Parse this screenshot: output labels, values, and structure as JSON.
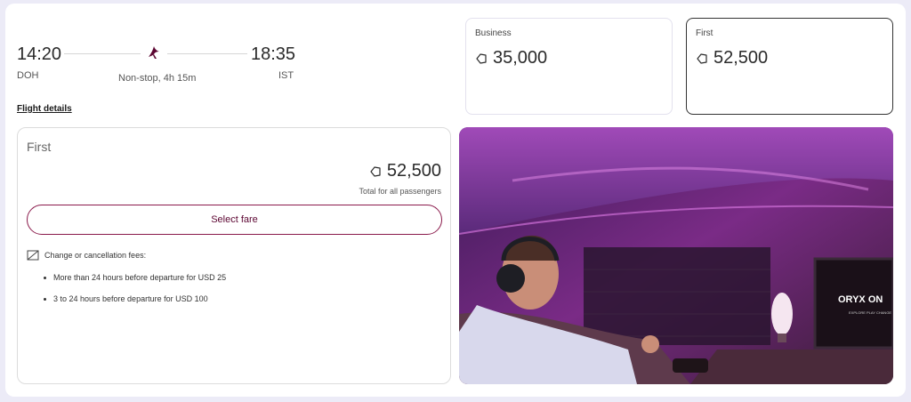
{
  "flight": {
    "depart_time": "14:20",
    "depart_code": "DOH",
    "arrive_time": "18:35",
    "arrive_code": "IST",
    "duration": "Non-stop, 4h 15m",
    "details_link": "Flight details"
  },
  "fare_tabs": [
    {
      "class": "Business",
      "points": "35,000",
      "selected": false
    },
    {
      "class": "First",
      "points": "52,500",
      "selected": true
    }
  ],
  "selected_fare": {
    "class": "First",
    "points": "52,500",
    "subtitle": "Total for all passengers",
    "select_label": "Select fare",
    "fees_heading": "Change or cancellation fees:",
    "fees": [
      "More than 24 hours before departure for USD 25",
      "3 to 24 hours before departure for USD 100"
    ]
  },
  "photo": {
    "screen_brand": "ORYX ON",
    "screen_tagline": "EXPLORE PLAY CHANGE"
  },
  "icons": {
    "airline": "airline-logo-icon",
    "points": "avios-tag-icon",
    "fees": "no-change-icon"
  },
  "colors": {
    "accent": "#5c0632",
    "button_border": "#8a1a4b",
    "page_bg": "#ecebf7"
  }
}
